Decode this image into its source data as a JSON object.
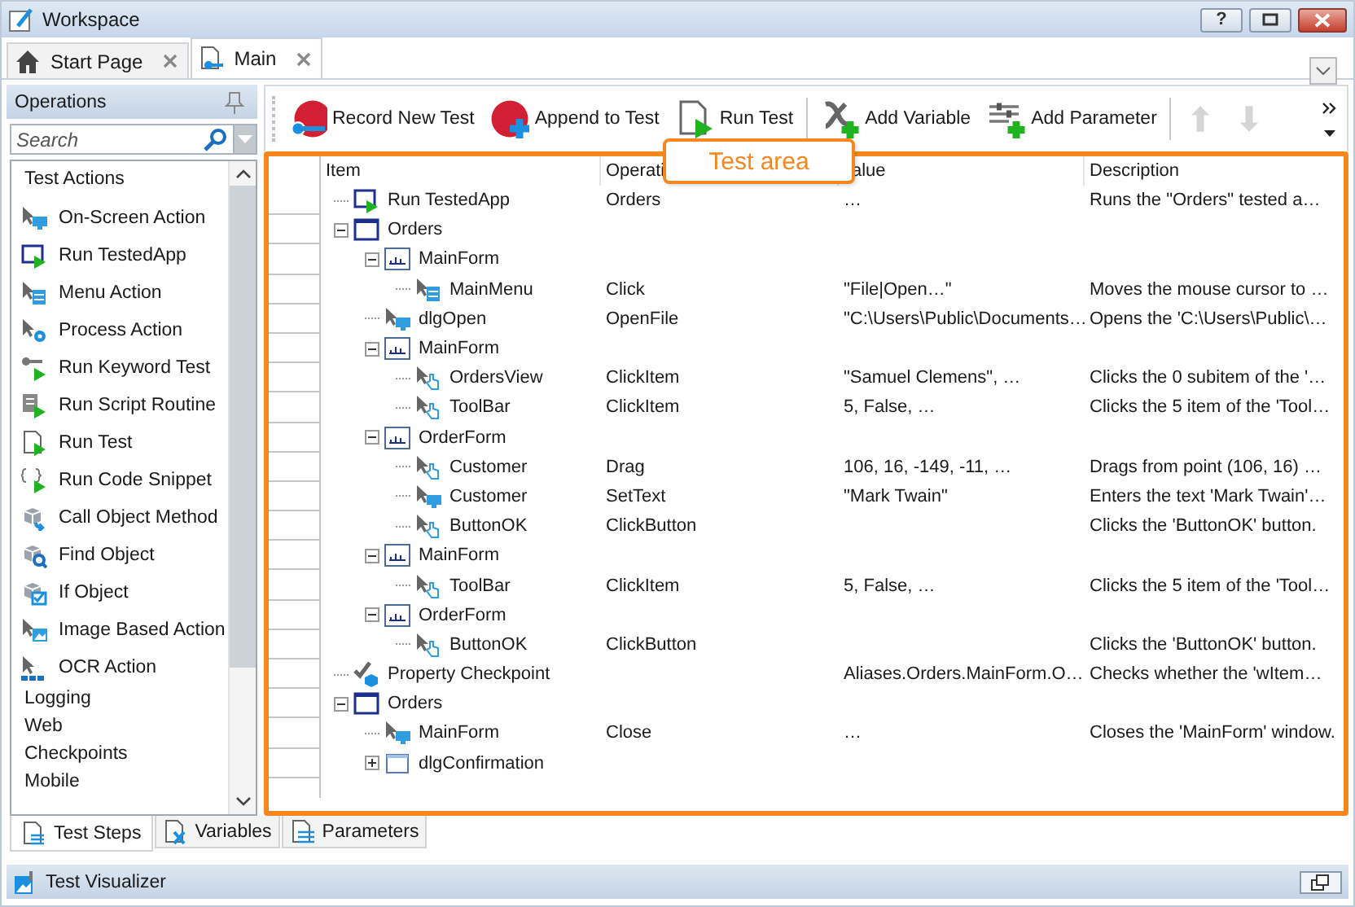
{
  "window": {
    "title": "Workspace",
    "help_label": "?"
  },
  "doc_tabs": [
    {
      "label": "Start Page",
      "kind": "home",
      "selected": false
    },
    {
      "label": "Main",
      "kind": "testdoc",
      "selected": true
    }
  ],
  "operations_panel": {
    "title": "Operations",
    "search": {
      "placeholder": "Search"
    },
    "groups": [
      {
        "label": "Test Actions",
        "items": [
          {
            "label": "On-Screen Action",
            "kind": "screen"
          },
          {
            "label": "Run TestedApp",
            "kind": "run"
          },
          {
            "label": "Menu Action",
            "kind": "menu"
          },
          {
            "label": "Process Action",
            "kind": "process"
          },
          {
            "label": "Run Keyword Test",
            "kind": "keyword"
          },
          {
            "label": "Run Script Routine",
            "kind": "script"
          },
          {
            "label": "Run Test",
            "kind": "runtest"
          },
          {
            "label": "Run Code Snippet",
            "kind": "snippet"
          },
          {
            "label": "Call Object Method",
            "kind": "callmethod"
          },
          {
            "label": "Find Object",
            "kind": "find"
          },
          {
            "label": "If Object",
            "kind": "ifobject"
          },
          {
            "label": "Image Based Action",
            "kind": "image"
          },
          {
            "label": "OCR Action",
            "kind": "ocr"
          }
        ]
      },
      {
        "label": "Logging"
      },
      {
        "label": "Web"
      },
      {
        "label": "Checkpoints"
      },
      {
        "label": "Mobile"
      }
    ]
  },
  "toolbar": {
    "buttons": [
      {
        "label": "Record New Test",
        "kind": "record"
      },
      {
        "label": "Append to Test",
        "kind": "append"
      },
      {
        "label": "Run Test",
        "kind": "runtest"
      },
      {
        "label": "Add Variable",
        "kind": "addvar"
      },
      {
        "label": "Add Parameter",
        "kind": "addparam"
      }
    ],
    "arrows": [
      {
        "kind": "up",
        "disabled": true
      },
      {
        "kind": "down",
        "disabled": true
      }
    ]
  },
  "callout": {
    "text": "Test area"
  },
  "grid": {
    "columns": [
      "Item",
      "Operati",
      "alue",
      "Description"
    ],
    "rows": [
      {
        "item": "Run TestedApp",
        "kind": "run",
        "operation": "Orders",
        "value": "…",
        "description": "Runs the \"Orders\" tested a…"
      },
      {
        "item": "Orders",
        "kind": "window",
        "expanded": true,
        "children": [
          {
            "item": "MainForm",
            "kind": "net",
            "expanded": true,
            "children": [
              {
                "item": "MainMenu",
                "kind": "menu",
                "operation": "Click",
                "value": "\"File|Open…\"",
                "description": "Moves the mouse cursor to …"
              }
            ]
          },
          {
            "item": "dlgOpen",
            "kind": "screen",
            "operation": "OpenFile",
            "value": "\"C:\\Users\\Public\\Documents…",
            "description": "Opens the 'C:\\Users\\Public\\…"
          },
          {
            "item": "MainForm",
            "kind": "net",
            "expanded": true,
            "children": [
              {
                "item": "OrdersView",
                "kind": "click",
                "operation": "ClickItem",
                "value": "\"Samuel Clemens\", …",
                "description": "Clicks the 0 subitem of the '…"
              },
              {
                "item": "ToolBar",
                "kind": "click",
                "operation": "ClickItem",
                "value": "5, False, …",
                "description": "Clicks the 5 item of the 'Tool…"
              }
            ]
          },
          {
            "item": "OrderForm",
            "kind": "net",
            "expanded": true,
            "children": [
              {
                "item": "Customer",
                "kind": "hand",
                "operation": "Drag",
                "value": "106, 16, -149, -11, …",
                "description": "Drags from point (106, 16) …"
              },
              {
                "item": "Customer",
                "kind": "screen",
                "operation": "SetText",
                "value": "\"Mark Twain\"",
                "description": "Enters the text 'Mark Twain'…"
              },
              {
                "item": "ButtonOK",
                "kind": "click",
                "operation": "ClickButton",
                "description": "Clicks the 'ButtonOK' button."
              }
            ]
          },
          {
            "item": "MainForm",
            "kind": "net",
            "expanded": true,
            "children": [
              {
                "item": "ToolBar",
                "kind": "click",
                "operation": "ClickItem",
                "value": "5, False, …",
                "description": "Clicks the 5 item of the 'Tool…"
              }
            ]
          },
          {
            "item": "OrderForm",
            "kind": "net",
            "expanded": true,
            "children": [
              {
                "item": "ButtonOK",
                "kind": "click",
                "operation": "ClickButton",
                "description": "Clicks the 'ButtonOK' button."
              }
            ]
          }
        ]
      },
      {
        "item": "Property Checkpoint",
        "kind": "checkpoint",
        "value": "Aliases.Orders.MainForm.O…",
        "description": "Checks whether the 'wItem…"
      },
      {
        "item": "Orders",
        "kind": "window",
        "expanded": true,
        "children": [
          {
            "item": "MainForm",
            "kind": "screen",
            "operation": "Close",
            "value": "…",
            "description": "Closes the 'MainForm' window."
          },
          {
            "item": "dlgConfirmation",
            "kind": "dialog",
            "expanded": false
          }
        ]
      }
    ]
  },
  "bottom_tabs": [
    {
      "label": "Test Steps",
      "kind": "steps",
      "selected": true
    },
    {
      "label": "Variables",
      "kind": "variables",
      "selected": false
    },
    {
      "label": "Parameters",
      "kind": "parameters",
      "selected": false
    }
  ],
  "visualizer": {
    "title": "Test Visualizer"
  }
}
